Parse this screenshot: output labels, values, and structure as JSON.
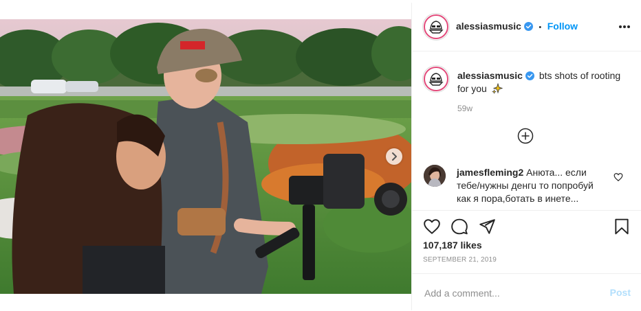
{
  "post": {
    "author": {
      "username": "alessiasmusic",
      "verified": true,
      "separator": "•",
      "follow_label": "Follow"
    },
    "more_icon": "more-horizontal-icon",
    "caption": {
      "username": "alessiasmusic",
      "text": "bts shots of rooting for you",
      "emoji": "sparkles",
      "age": "59w"
    },
    "load_more_icon": "plus-circle-icon",
    "comments": [
      {
        "username": "jamesfleming2",
        "text": "Анюта... если тебе/нужны денгu то попробуй как я пора,ботать в инете..."
      }
    ],
    "media": {
      "next_icon": "chevron-right-icon",
      "carousel_count": 5,
      "carousel_active": 0
    },
    "actions": {
      "like_icon": "heart-icon",
      "comment_icon": "comment-icon",
      "share_icon": "paper-plane-icon",
      "save_icon": "bookmark-icon"
    },
    "likes_text": "107,187 likes",
    "date": "SEPTEMBER 21, 2019",
    "add_comment": {
      "placeholder": "Add a comment...",
      "post_label": "Post"
    },
    "colors": {
      "accent": "#0095f6",
      "post_disabled": "#b2dffc",
      "verified_badge": "#3897f0"
    }
  }
}
